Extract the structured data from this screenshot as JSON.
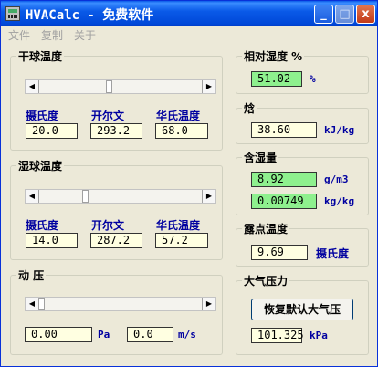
{
  "title": "HVACalc - 免费软件",
  "titlebar_buttons": {
    "minimize": "_",
    "maximize": "□",
    "close": "x"
  },
  "menu": [
    "文件",
    "复制",
    "关于"
  ],
  "dry_bulb": {
    "title": "干球温度",
    "celsius_label": "摄氏度",
    "kelvin_label": "开尔文",
    "fahrenheit_label": "华氏温度",
    "celsius": "20.0",
    "kelvin": "293.2",
    "fahrenheit": "68.0",
    "slider_position": 0.43
  },
  "wet_bulb": {
    "title": "湿球温度",
    "celsius_label": "摄氏度",
    "kelvin_label": "开尔文",
    "fahrenheit_label": "华氏温度",
    "celsius": "14.0",
    "kelvin": "287.2",
    "fahrenheit": "57.2",
    "slider_position": 0.28
  },
  "dynamic_pressure": {
    "title": "动 压",
    "pa_value": "0.00",
    "pa_unit": "Pa",
    "speed_value": "0.0",
    "speed_unit": "m/s",
    "slider_position": 0.0
  },
  "relative_humidity": {
    "title": "相对湿度 %",
    "value": "51.02",
    "unit": "%"
  },
  "enthalpy": {
    "title": "焓",
    "value": "38.60",
    "unit": "kJ/kg"
  },
  "moisture": {
    "title": "含湿量",
    "value1": "8.92",
    "unit1": "g/m3",
    "value2": "0.00749",
    "unit2": "kg/kg"
  },
  "dew_point": {
    "title": "露点温度",
    "value": "9.69",
    "unit": "摄氏度"
  },
  "atmospheric": {
    "title": "大气压力",
    "button": "恢复默认大气压",
    "value": "101.325",
    "unit": "kPa"
  },
  "colors": {
    "title_bar": "#0a5ae8",
    "field_yellow": "#ffffe1",
    "field_green": "#8ef08e",
    "label_blue": "#0000a0"
  }
}
